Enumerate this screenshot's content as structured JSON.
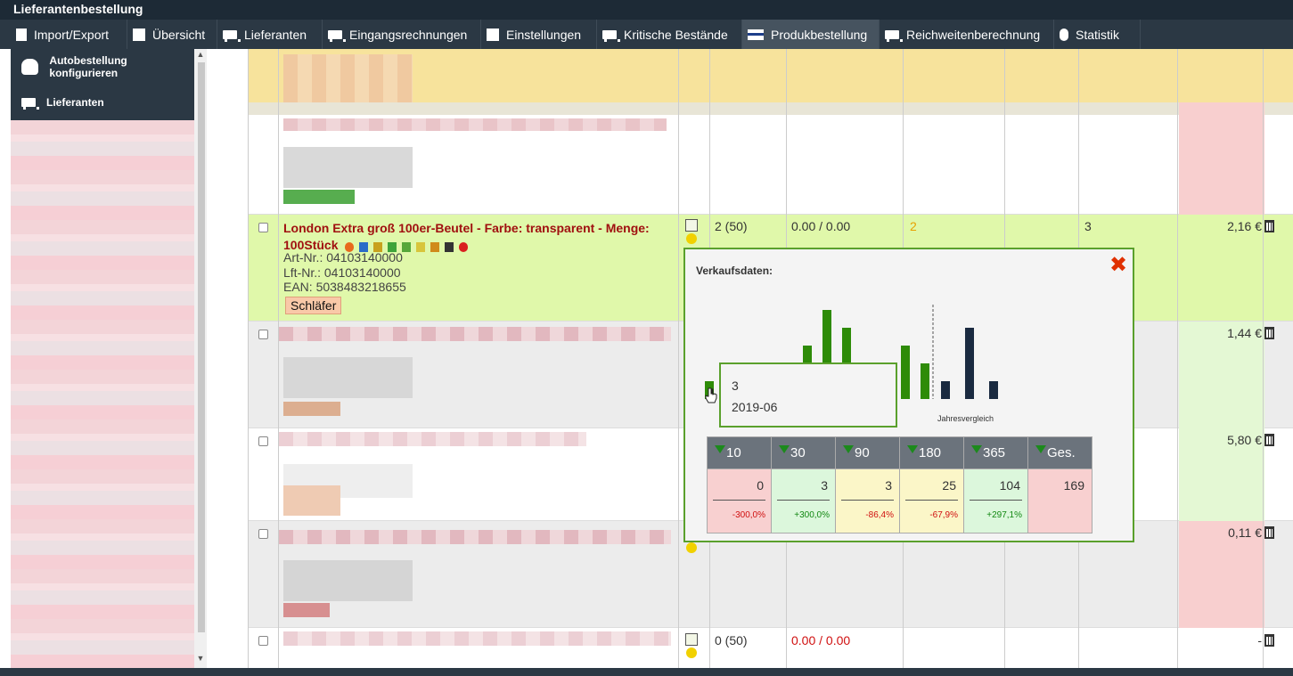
{
  "app": {
    "title": "Lieferantenbestellung"
  },
  "nav": {
    "tabs": [
      {
        "label": "Import/Export",
        "icon": "document-icon"
      },
      {
        "label": "Übersicht",
        "icon": "box-icon"
      },
      {
        "label": "Lieferanten",
        "icon": "truck-icon"
      },
      {
        "label": "Eingangsrechnungen",
        "icon": "truck-icon"
      },
      {
        "label": "Einstellungen",
        "icon": "box-icon"
      },
      {
        "label": "Kritische Bestände",
        "icon": "truck-icon"
      },
      {
        "label": "Produkbestellung",
        "icon": "card-icon",
        "active": true
      },
      {
        "label": "Reichweitenberechnung",
        "icon": "truck-icon"
      },
      {
        "label": "Statistik",
        "icon": "medal-icon"
      }
    ]
  },
  "sidebar": {
    "items": [
      {
        "label": "Autobestellung konfigurieren",
        "icon": "users-icon"
      },
      {
        "label": "Lieferanten",
        "icon": "truck-icon"
      }
    ]
  },
  "product": {
    "title": "London Extra groß 100er-Beutel - Farbe: transparent - Menge: 100Stück",
    "art_nr": "Art-Nr.: 04103140000",
    "lft_nr": "Lft-Nr.: 04103140000",
    "ean": "EAN: 5038483218655",
    "badge": "Schläfer",
    "stock": "2 (50)",
    "amounts": "0.00 / 0.00",
    "orange_value": "2",
    "col_value": "3",
    "price": "2,16 €"
  },
  "rows": [
    {
      "price": "1,44 €"
    },
    {
      "price": "5,80 €"
    },
    {
      "price": "0,11 €"
    },
    {
      "stock": "0 (50)",
      "amounts": "0.00 / 0.00",
      "price": "-"
    }
  ],
  "popup": {
    "title": "Verkaufsdaten:",
    "tooltip_value": "3",
    "tooltip_date": "2019-06",
    "compare_label": "Jahresvergleich",
    "stats": {
      "headers": [
        "10",
        "30",
        "90",
        "180",
        "365",
        "Ges."
      ],
      "values": [
        "0",
        "3",
        "3",
        "25",
        "104",
        "169"
      ],
      "percents": [
        "-300,0%",
        "+300,0%",
        "-86,4%",
        "-67,9%",
        "+297,1%",
        ""
      ]
    }
  },
  "chart_data": {
    "type": "bar",
    "series": [
      {
        "values": [
          1,
          0,
          0,
          0,
          0,
          3,
          5,
          4,
          0,
          2,
          3,
          2
        ]
      },
      {
        "values": [
          1,
          4,
          1
        ]
      }
    ],
    "ylim": [
      0,
      5
    ],
    "colors": {
      "monthly": "#2e8b08",
      "yearly": "#1a2a40"
    }
  }
}
